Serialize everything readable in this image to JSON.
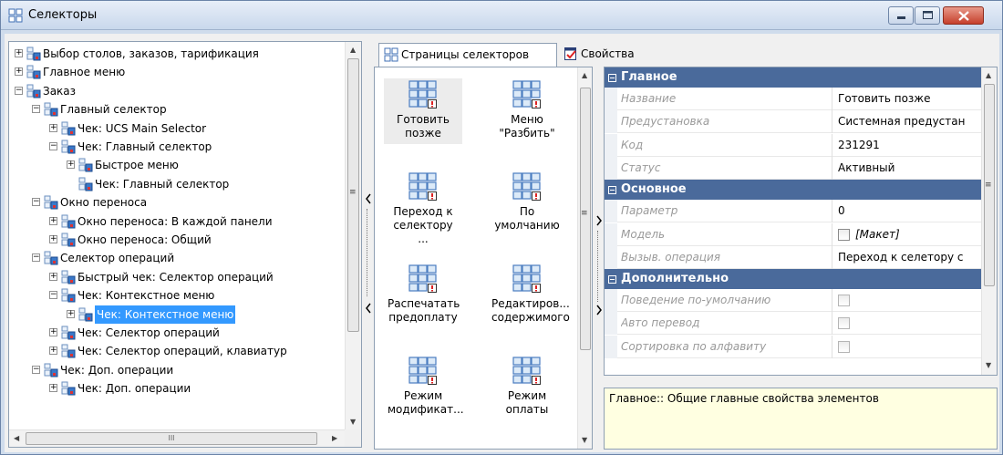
{
  "window": {
    "title": "Селекторы"
  },
  "tree": {
    "items": [
      {
        "label": "Выбор столов, заказов, тарификация",
        "level": 0,
        "expander": "+"
      },
      {
        "label": "Главное меню",
        "level": 0,
        "expander": "+"
      },
      {
        "label": "Заказ",
        "level": 0,
        "expander": "-"
      },
      {
        "label": "Главный селектор",
        "level": 1,
        "expander": "-"
      },
      {
        "label": "Чек: UCS Main Selector",
        "level": 2,
        "expander": "+"
      },
      {
        "label": "Чек: Главный селектор",
        "level": 2,
        "expander": "-"
      },
      {
        "label": "Быстрое меню",
        "level": 3,
        "expander": "+"
      },
      {
        "label": "Чек: Главный селектор",
        "level": 3,
        "expander": ""
      },
      {
        "label": "Окно переноса",
        "level": 1,
        "expander": "-"
      },
      {
        "label": "Окно переноса: В каждой панели",
        "level": 2,
        "expander": "+"
      },
      {
        "label": "Окно переноса: Общий",
        "level": 2,
        "expander": "+"
      },
      {
        "label": "Селектор операций",
        "level": 1,
        "expander": "-"
      },
      {
        "label": "Быстрый чек: Селектор операций",
        "level": 2,
        "expander": "+"
      },
      {
        "label": "Чек: Контекстное меню",
        "level": 2,
        "expander": "-"
      },
      {
        "label": "Чек: Контекстное меню",
        "level": 3,
        "expander": "+",
        "selected": true
      },
      {
        "label": "Чек: Селектор операций",
        "level": 2,
        "expander": "+"
      },
      {
        "label": "Чек: Селектор операций, клавиатур",
        "level": 2,
        "expander": "+"
      },
      {
        "label": "Чек: Доп. операции",
        "level": 1,
        "expander": "-"
      },
      {
        "label": "Чек: Доп. операции",
        "level": 2,
        "expander": "+"
      }
    ],
    "hscroll_thumb_glyph": "III"
  },
  "tabs": [
    {
      "label": "Страницы селекторов",
      "icon": "grid-icon",
      "active": true
    },
    {
      "label": "Свойства",
      "icon": "properties-icon",
      "active": false
    }
  ],
  "selectors": [
    {
      "label": "Готовить позже",
      "highlight": true
    },
    {
      "label": "Меню \"Разбить\"",
      "highlight": false
    },
    {
      "label": "Переход к селектору ...",
      "highlight": false
    },
    {
      "label": "По умолчанию",
      "highlight": false
    },
    {
      "label": "Распечатать предоплату",
      "highlight": false
    },
    {
      "label": "Редактиров... содержимого",
      "highlight": false
    },
    {
      "label": "Режим модификат...",
      "highlight": false
    },
    {
      "label": "Режим оплаты",
      "highlight": false
    }
  ],
  "properties": {
    "categories": [
      {
        "label": "Главное",
        "rows": [
          {
            "name": "Название",
            "value": "Готовить позже"
          },
          {
            "name": "Предустановка",
            "value": "Системная предустан"
          },
          {
            "name": "Код",
            "value": "231291"
          },
          {
            "name": "Статус",
            "value": "Активный"
          }
        ]
      },
      {
        "label": "Основное",
        "rows": [
          {
            "name": "Параметр",
            "value": "0"
          },
          {
            "name": "Модель",
            "value": "[Макет]",
            "checkbox": true
          },
          {
            "name": "Вызыв. операция",
            "value": "Переход к селетору с"
          }
        ]
      },
      {
        "label": "Дополнительно",
        "rows": [
          {
            "name": "Поведение по-умолчанию",
            "value": "",
            "checkbox": true
          },
          {
            "name": "Авто перевод",
            "value": "",
            "checkbox": true
          },
          {
            "name": "Сортировка по алфавиту",
            "value": "",
            "checkbox": true
          }
        ]
      }
    ]
  },
  "description": "Главное:: Общие главные свойства элементов",
  "colors": {
    "category_bg": "#4a6a9b",
    "selection": "#3399ff",
    "description_bg": "#ffffe1"
  }
}
